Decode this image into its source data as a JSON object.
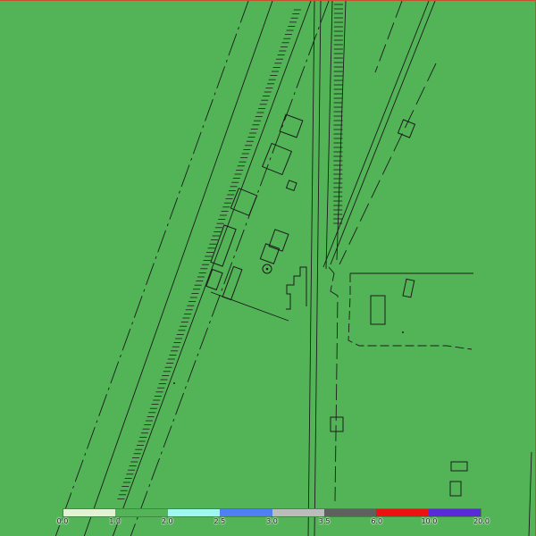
{
  "legend": {
    "ticks": [
      "0.0",
      "1.0",
      "2.0",
      "2.5",
      "3.0",
      "3.5",
      "6.0",
      "10.0",
      "20.0"
    ],
    "colors": [
      "#e3f2d4",
      "#52b456",
      "#9ef8f0",
      "#4f7ff0",
      "#bcbcbc",
      "#606060",
      "#ee1111",
      "#5a2ad8"
    ]
  },
  "map": {
    "fill_color": "#52b456",
    "border_color": "#c9502f",
    "linework_color": "#1b1b1b"
  }
}
